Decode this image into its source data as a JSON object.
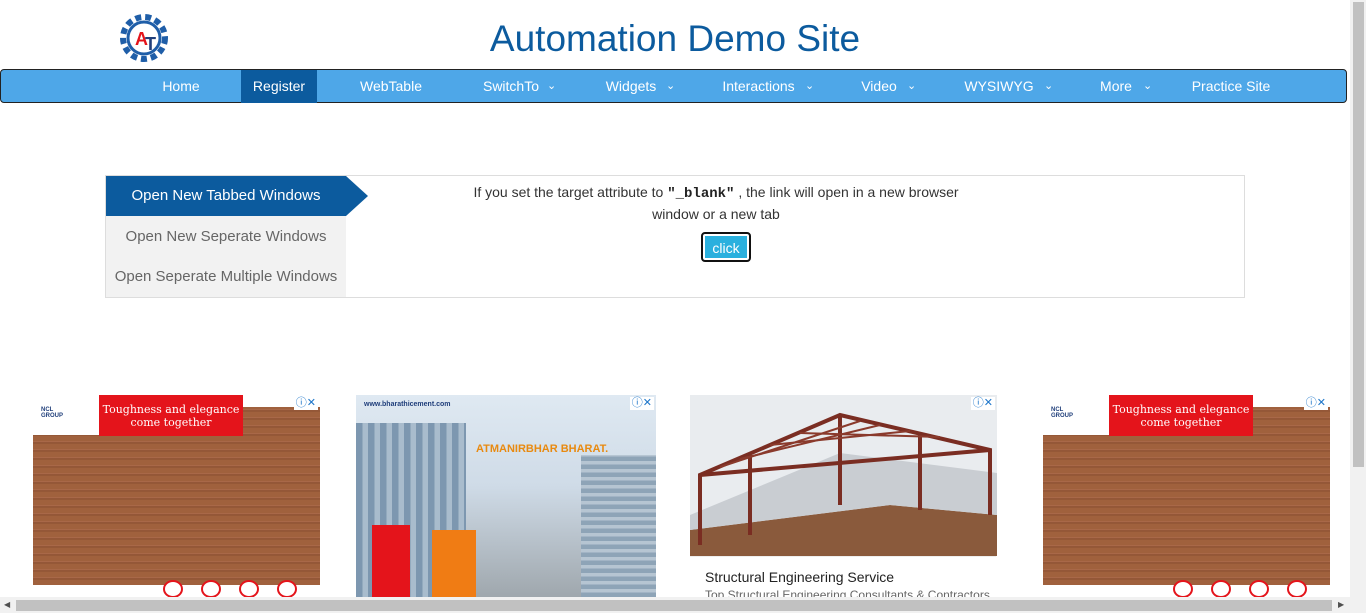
{
  "header": {
    "title": "Automation Demo Site",
    "logo_icon": "gear-logo-icon",
    "logo_text": "AT"
  },
  "nav": {
    "items": [
      {
        "label": "Home"
      },
      {
        "label": "Register"
      },
      {
        "label": "WebTable"
      },
      {
        "label": "SwitchTo"
      },
      {
        "label": "Widgets"
      },
      {
        "label": "Interactions"
      },
      {
        "label": "Video"
      },
      {
        "label": "WYSIWYG"
      },
      {
        "label": "More"
      },
      {
        "label": "Practice Site"
      }
    ],
    "active": "Register",
    "chevron": "⌄"
  },
  "tabs": {
    "items": [
      {
        "label": "Open New Tabbed Windows"
      },
      {
        "label": "Open New Seperate Windows"
      },
      {
        "label": "Open Seperate Multiple Windows"
      }
    ],
    "active": "Open New Tabbed Windows"
  },
  "content": {
    "text_before": "If you set the target attribute to ",
    "keyword": "\"_blank\"",
    "text_after": " , the link will open in a new browser window or a new tab",
    "button_label": "click"
  },
  "ads": {
    "choices_icon": "ⓘ✕",
    "ncl": {
      "group": "NCL GROUP",
      "banner_line1": "Toughness and elegance",
      "banner_line2": "come together"
    },
    "bharathi": {
      "url": "www.bharathicement.com",
      "slogan": "ATMANIRBHAR BHARAT."
    },
    "steel": {
      "title": "Structural Engineering Service",
      "subtitle": "Top Structural Engineering Consultants & Contractors"
    }
  },
  "colors": {
    "nav_bg": "#4ea7e8",
    "active_bg": "#0c5b9e",
    "title_color": "#0c5b9e",
    "button_bg": "#2ab0de"
  }
}
